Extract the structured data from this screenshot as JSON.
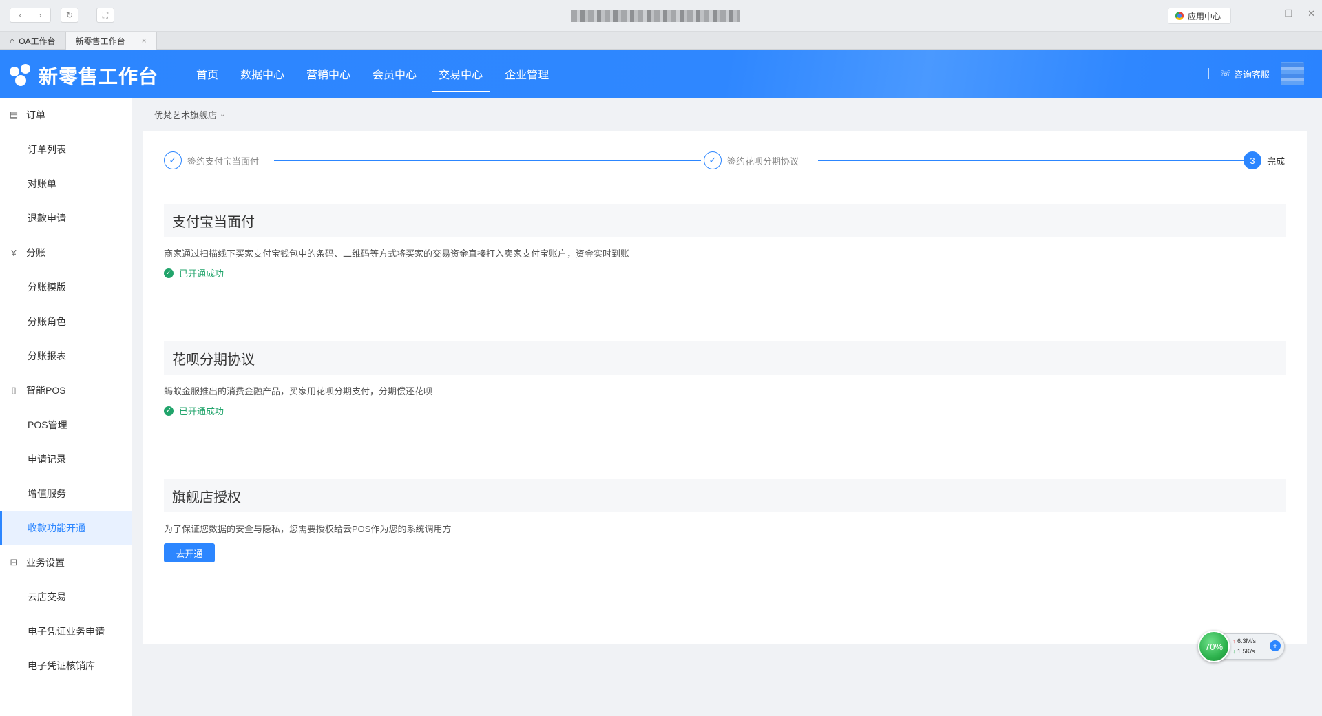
{
  "browser": {
    "app_center_label": "应用中心",
    "tabs": [
      {
        "label": "OA工作台",
        "icon": "home-icon"
      },
      {
        "label": "新零售工作台",
        "close": "×"
      }
    ]
  },
  "header": {
    "app_title": "新零售工作台",
    "nav": [
      {
        "label": "首页"
      },
      {
        "label": "数据中心"
      },
      {
        "label": "营销中心"
      },
      {
        "label": "会员中心"
      },
      {
        "label": "交易中心",
        "active": true
      },
      {
        "label": "企业管理"
      }
    ],
    "service_label": "咨询客服"
  },
  "sidebar": {
    "groups": [
      {
        "label": "订单",
        "icon": "document-icon",
        "items": [
          "订单列表",
          "对账单",
          "退款申请"
        ]
      },
      {
        "label": "分账",
        "icon": "yen-icon",
        "items": [
          "分账模版",
          "分账角色",
          "分账报表"
        ]
      },
      {
        "label": "智能POS",
        "icon": "pos-device-icon",
        "items": [
          "POS管理",
          "申请记录",
          "增值服务",
          "收款功能开通"
        ]
      },
      {
        "label": "业务设置",
        "icon": "briefcase-icon",
        "items": [
          "云店交易",
          "电子凭证业务申请",
          "电子凭证核销库"
        ]
      }
    ],
    "active_item": "收款功能开通"
  },
  "content": {
    "store_name": "优梵艺术旗舰店",
    "steps": [
      {
        "label": "签约支付宝当面付",
        "state": "done"
      },
      {
        "label": "签约花呗分期协议",
        "state": "done"
      },
      {
        "label": "完成",
        "number": "3",
        "state": "current"
      }
    ],
    "sections": [
      {
        "title": "支付宝当面付",
        "description": "商家通过扫描线下买家支付宝钱包中的条码、二维码等方式将买家的交易资金直接打入卖家支付宝账户，资金实时到账",
        "status": "已开通成功"
      },
      {
        "title": "花呗分期协议",
        "description": "蚂蚁金服推出的消费金融产品，买家用花呗分期支付，分期偿还花呗",
        "status": "已开通成功"
      },
      {
        "title": "旗舰店授权",
        "description": "为了保证您数据的安全与隐私，您需要授权给云POS作为您的系统调用方",
        "button": "去开通"
      }
    ]
  },
  "speed_widget": {
    "percent": "70%",
    "upload": "6.3M/s",
    "download": "1.5K/s"
  },
  "colors": {
    "primary": "#2c86ff",
    "success": "#21a46b",
    "sidebar_active_bg": "#e8f1ff"
  }
}
